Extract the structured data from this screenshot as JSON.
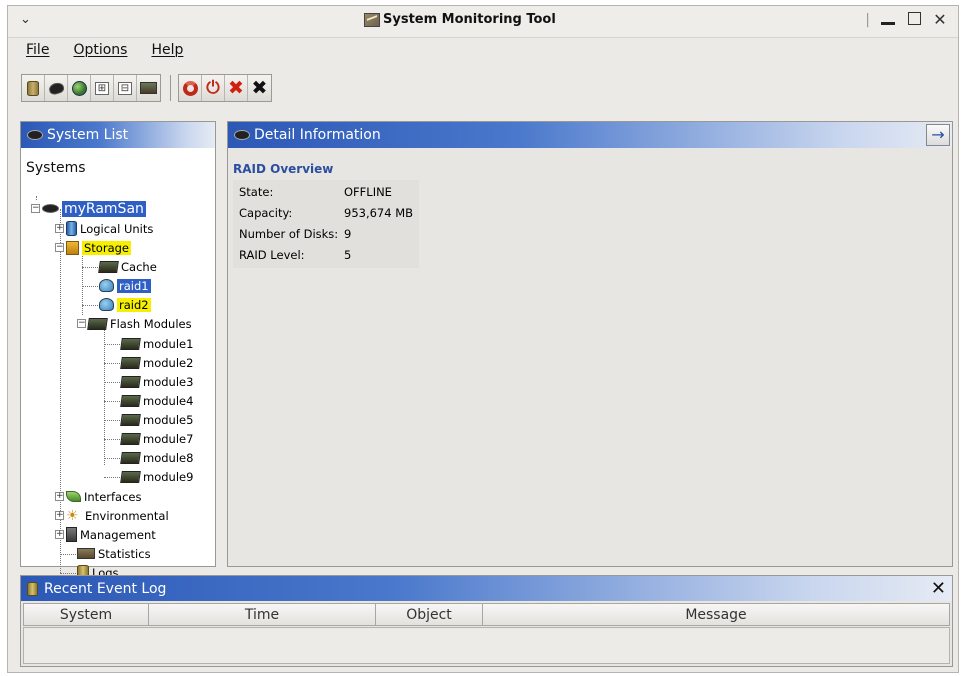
{
  "window": {
    "title": "System Monitoring Tool",
    "menu_glyph": "⌄",
    "controls": {
      "separator": "|",
      "close": "✕"
    }
  },
  "menu": {
    "items": [
      "File",
      "Options",
      "Help"
    ]
  },
  "toolbar": {
    "group1": [
      "database-icon",
      "disc-icon",
      "globe-icon",
      "expand-tree-icon",
      "collapse-tree-icon",
      "chart-icon"
    ],
    "group2": [
      "refresh-icon",
      "power-icon",
      "delete-icon",
      "close-icon"
    ],
    "glyphs": {
      "expand": "⊞",
      "collapse": "⊟",
      "power": "⏻",
      "delete": "✖",
      "close": "✖"
    }
  },
  "system_list": {
    "header": "System List",
    "root": "Systems",
    "system": "myRamSan",
    "items": {
      "logical_units": "Logical Units",
      "storage": "Storage",
      "cache": "Cache",
      "raid1": "raid1",
      "raid2": "raid2",
      "flash_modules": "Flash Modules",
      "modules": [
        "module1",
        "module2",
        "module3",
        "module4",
        "module5",
        "module7",
        "module8",
        "module9"
      ],
      "interfaces": "Interfaces",
      "environmental": "Environmental",
      "management": "Management",
      "statistics": "Statistics",
      "logs": "Logs"
    },
    "expander": {
      "plus": "+",
      "minus": "−"
    }
  },
  "detail": {
    "header": "Detail Information",
    "header_button": "→",
    "section_title": "RAID Overview",
    "rows": [
      {
        "key": "State:",
        "value": "OFFLINE"
      },
      {
        "key": "Capacity:",
        "value": "953,674 MB"
      },
      {
        "key": "Number of Disks:",
        "value": "9"
      },
      {
        "key": "RAID Level:",
        "value": "5"
      }
    ]
  },
  "event_log": {
    "header": "Recent Event Log",
    "close": "✕",
    "columns": [
      "System",
      "Time",
      "Object",
      "Message"
    ]
  },
  "colors": {
    "header_blue": "#2c58b6",
    "selection_blue": "#2f5fc4",
    "highlight_yellow": "#f6f000",
    "raid_title": "#2a4ea0"
  }
}
